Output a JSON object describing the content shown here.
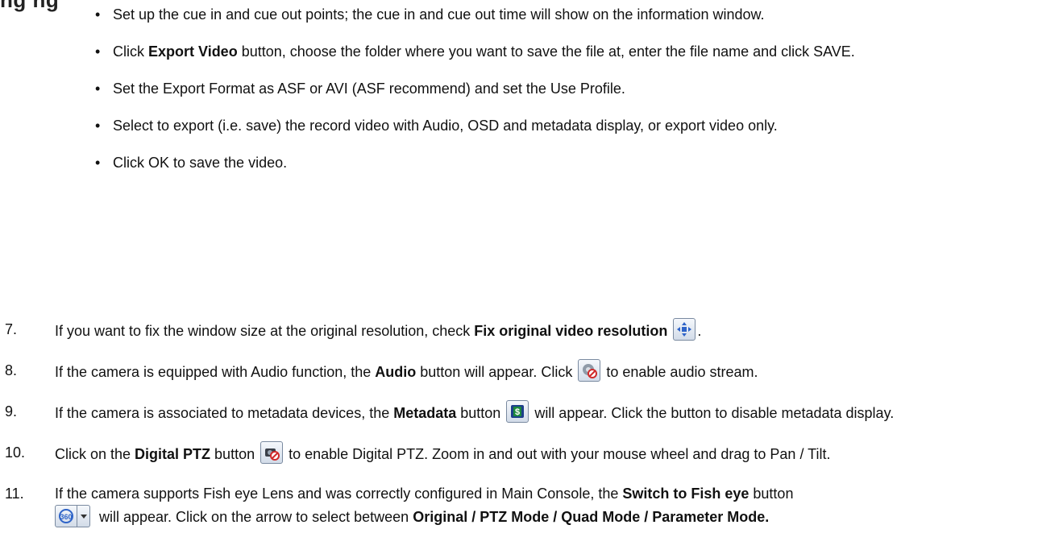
{
  "heading_fragment": "ng ng",
  "bullets": [
    {
      "pre": "Set up the cue in and cue out points; the cue in and cue out time will show on the information window.",
      "bold": "",
      "post": ""
    },
    {
      "pre": "Click ",
      "bold": "Export Video",
      "post": " button, choose the folder where you want to save the file at, enter the file name and click SAVE."
    },
    {
      "pre": "Set the Export Format as ASF or AVI (ASF recommend) and set the Use Profile.",
      "bold": "",
      "post": ""
    },
    {
      "pre": "Select to export (i.e. save) the record video with Audio, OSD and metadata display, or export video only.",
      "bold": "",
      "post": ""
    },
    {
      "pre": "Click OK to save the video.",
      "bold": "",
      "post": ""
    }
  ],
  "steps": {
    "s7": {
      "num": "7.",
      "pre": "If you want to fix the window size at the original resolution, check ",
      "bold": "Fix original video resolution",
      "post": "."
    },
    "s8": {
      "num": "8.",
      "pre": "If the camera is equipped with Audio function, the ",
      "bold": "Audio",
      "mid": " button will appear. Click ",
      "post": " to enable audio stream."
    },
    "s9": {
      "num": "9.",
      "pre": "If the camera is associated to metadata devices, the ",
      "bold": "Metadata",
      "mid": " button ",
      "post": " will appear. Click the button to disable metadata display."
    },
    "s10": {
      "num": "10.",
      "pre": "Click on the ",
      "bold": "Digital PTZ",
      "mid": " button ",
      "post": " to enable Digital PTZ.  Zoom in and out with your mouse wheel and drag to Pan / Tilt."
    },
    "s11": {
      "num": "11.",
      "pre": "If the camera supports Fish eye Lens and was correctly configured in Main Console, the ",
      "bold": "Switch to Fish eye",
      "mid": " button",
      "post": " will appear.  Click on the arrow to select between ",
      "bold2": "Original / PTZ Mode / Quad Mode / Parameter Mode."
    }
  },
  "icons": {
    "fix_resolution": "fix-resolution-icon",
    "audio": "audio-icon",
    "metadata": "metadata-icon",
    "digital_ptz": "digital-ptz-icon",
    "fish_eye": "fish-eye-icon"
  },
  "colors": {
    "icon_border": "#7a8aa0",
    "icon_blue": "#2f64c8",
    "metadata_green": "#1d8a3c",
    "no_red": "#d02a2a"
  }
}
